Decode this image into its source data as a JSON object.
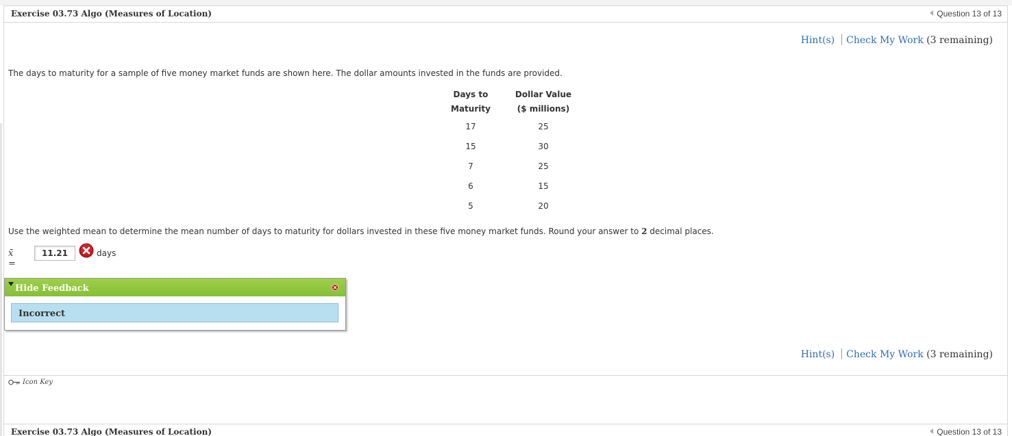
{
  "header": {
    "exercise_title": "Exercise 03.73 Algo (Measures of Location)",
    "question_nav": "Question 13 of 13"
  },
  "actions": {
    "hints_label": "Hint(s)",
    "check_work_label": "Check My Work",
    "remaining_text": "(3 remaining)"
  },
  "problem": {
    "intro_text": "The days to maturity for a sample of five money market funds are shown here. The dollar amounts invested in the funds are provided.",
    "table": {
      "col1_line1": "Days to",
      "col1_line2": "Maturity",
      "col2_line1": "Dollar Value",
      "col2_line2": "($ millions)",
      "rows": [
        {
          "days": "17",
          "dollars": "25"
        },
        {
          "days": "15",
          "dollars": "30"
        },
        {
          "days": "7",
          "dollars": "25"
        },
        {
          "days": "6",
          "dollars": "15"
        },
        {
          "days": "5",
          "dollars": "20"
        }
      ]
    },
    "question_text_before": "Use the weighted mean to determine the mean number of days to maturity for dollars invested in these five money market funds. Round your answer to ",
    "question_decimals": "2",
    "question_text_after": " decimal places."
  },
  "answer": {
    "symbol": "x̄ =",
    "value": "11.21",
    "unit": "days",
    "status": "incorrect"
  },
  "feedback": {
    "toggle_label": "Hide Feedback",
    "message": "Incorrect",
    "header_color": "#8cc63f",
    "body_color": "#b8dff0"
  },
  "footer": {
    "icon_key_label": "Icon Key",
    "exercise_title": "Exercise 03.73 Algo (Measures of Location)",
    "question_nav": "Question 13 of 13"
  },
  "colors": {
    "link": "#2f6fb5",
    "error": "#c4161c"
  }
}
